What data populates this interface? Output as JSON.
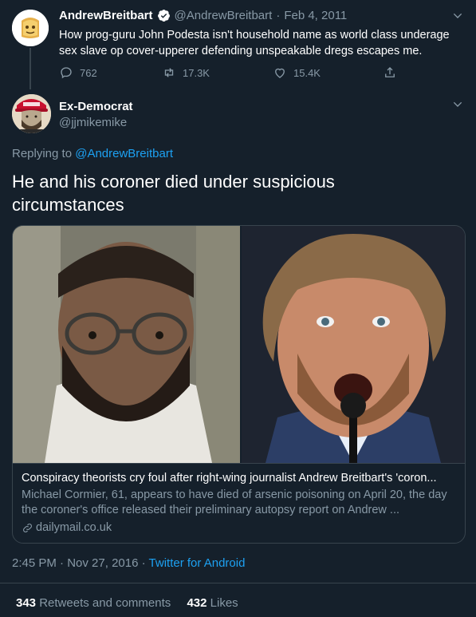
{
  "parent": {
    "display_name": "AndrewBreitbart",
    "handle": "@AndrewBreitbart",
    "date": "Feb 4, 2011",
    "text": "How prog-guru John Podesta isn't household name as world class underage sex slave op cover-upperer defending unspeakable dregs escapes me.",
    "replies": "762",
    "retweets": "17.3K",
    "likes": "15.4K"
  },
  "tweet": {
    "display_name": "Ex-Democrat",
    "handle": "@jjmikemike",
    "replying_to_label": "Replying to",
    "replying_to_handle": "@AndrewBreitbart",
    "text": "He and his coroner died under suspicious circumstances",
    "time": "2:45 PM",
    "date": "Nov 27, 2016",
    "source": "Twitter for Android",
    "retweets_count": "343",
    "retweets_label": "Retweets and comments",
    "likes_count": "432",
    "likes_label": "Likes"
  },
  "card": {
    "title": "Conspiracy theorists cry foul after right-wing journalist Andrew Breitbart's 'coron...",
    "description": "Michael Cormier, 61, appears to have died of arsenic poisoning on April 20, the day the coroner's office released their preliminary autopsy report on Andrew ...",
    "domain": "dailymail.co.uk"
  },
  "colors": {
    "background": "#15202b",
    "accent": "#1da1f2",
    "muted": "#8899a6",
    "border": "#38444d"
  }
}
